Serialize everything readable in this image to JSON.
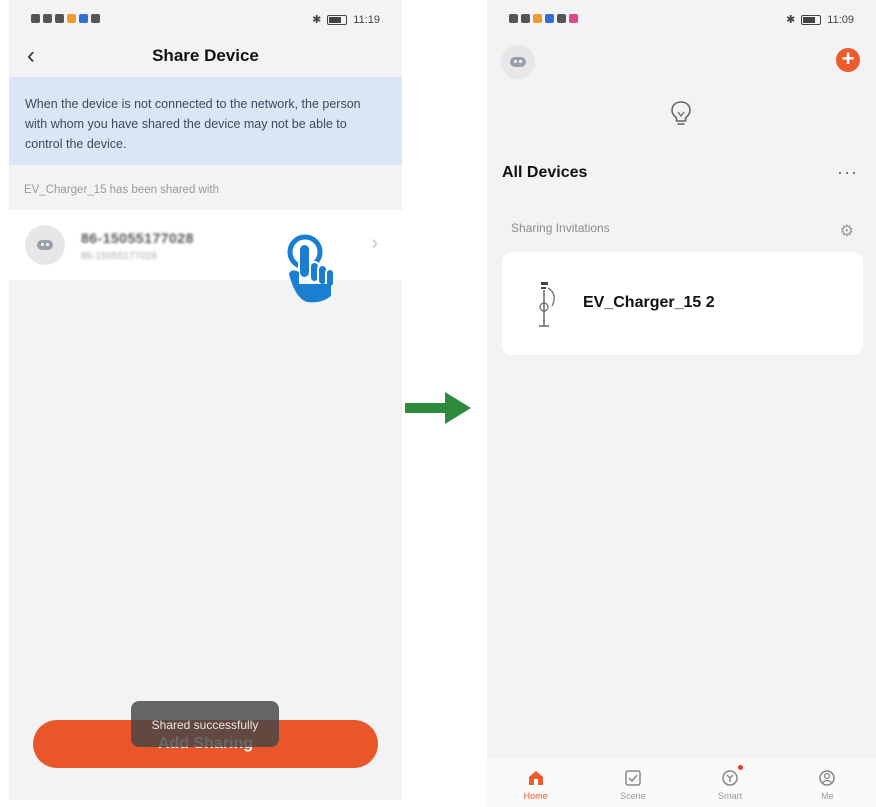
{
  "left_screen": {
    "status_bar": {
      "time": "11:19"
    },
    "title": "Share Device",
    "notice": "When the device is not connected to the network, the person with whom you have shared the device may not be able to control the device.",
    "shared_with_label": "EV_Charger_15 has been shared with",
    "shared_account": {
      "main": "86-15055177028",
      "sub": "86-15055177028"
    },
    "add_button_label": "Add Sharing",
    "toast": "Shared successfully"
  },
  "right_screen": {
    "status_bar": {
      "time": "11:09"
    },
    "section_title": "All Devices",
    "more_label": "···",
    "sharing_invitations_label": "Sharing Invitations",
    "device": {
      "name": "EV_Charger_15 2"
    },
    "tabs": [
      {
        "label": "Home",
        "icon": "home-icon",
        "active": true
      },
      {
        "label": "Scene",
        "icon": "scene-icon",
        "active": false
      },
      {
        "label": "Smart",
        "icon": "smart-icon",
        "active": false
      },
      {
        "label": "Me",
        "icon": "me-icon",
        "active": false
      }
    ]
  },
  "colors": {
    "accent": "#e8562a",
    "notice_bg": "#d9e6f5",
    "arrow": "#2e8b3e",
    "hand": "#1a7fd0"
  }
}
